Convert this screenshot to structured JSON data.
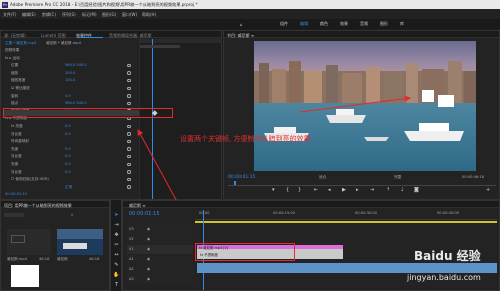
{
  "window": {
    "title": "Adobe Premiere Pro CC 2018 - E:\\百度经验\\图片和视频\\用PR做一个从暗到亮的视频效果.prproj *"
  },
  "menu": {
    "items": [
      "文件(F)",
      "编辑(E)",
      "剪辑(C)",
      "序列(S)",
      "标记(M)",
      "图形(G)",
      "窗口(W)",
      "帮助(H)"
    ]
  },
  "workspace_tabs": {
    "items": [
      "组件",
      "编辑",
      "颜色",
      "效果",
      "音频",
      "图形",
      "库"
    ],
    "active": "编辑"
  },
  "effect_controls": {
    "tabs": [
      "源: (无剪辑)",
      "Lumetri 范围",
      "效果控件",
      "音频剪辑混合器: 威尼斯"
    ],
    "active_tab": "效果控件",
    "clip_label": "主要 * 威尼斯.mp4",
    "sequence_label": "威尼斯 * 威尼斯.mp4",
    "rows": [
      {
        "label": "视频效果",
        "value": ""
      },
      {
        "label": "fx ▸ 运动",
        "value": ""
      },
      {
        "label": "位置",
        "value": "960.0  540.0"
      },
      {
        "label": "缩放",
        "value": "100.0"
      },
      {
        "label": "缩放宽度",
        "value": "100.0"
      },
      {
        "label": "☑ 等比缩放",
        "value": ""
      },
      {
        "label": "旋转",
        "value": "0.0"
      },
      {
        "label": "锚点",
        "value": "960.0  540.0"
      },
      {
        "label": "防闪烁滤镜",
        "value": "0.00"
      },
      {
        "label": "fx ▸ 不透明度",
        "value": ""
      },
      {
        "label": "fx 亮度",
        "value": "0.0"
      },
      {
        "label": "对比度",
        "value": "0.0"
      },
      {
        "label": "时间重映射",
        "value": ""
      },
      {
        "label": "亮度",
        "value": "0.0"
      },
      {
        "label": "对比度",
        "value": "0.0"
      },
      {
        "label": "亮度",
        "value": "0.0"
      },
      {
        "label": "对比度",
        "value": "0.0"
      },
      {
        "label": "☐ 使用旧版(支持 HDR)",
        "value": ""
      },
      {
        "label": "",
        "value": "正常"
      }
    ],
    "time": "00:00:01:15"
  },
  "program_monitor": {
    "tab": "节目: 威尼斯 ≡",
    "timecode": "00:00:01:15",
    "fit": "适合",
    "quality": "完整",
    "duration": "00:00:46:18"
  },
  "annotation": {
    "text": "设置两个关键帧, 方便制作从暗到亮的效果"
  },
  "project_panel": {
    "tabs": [
      "项目: 用PR做一个从暗到亮的视频效果",
      "媒体浏览器",
      "库",
      "信息"
    ],
    "items": [
      {
        "name": "威尼斯.mp4",
        "duration": "46:18"
      },
      {
        "name": "威尼斯",
        "duration": "46:18"
      }
    ]
  },
  "timeline": {
    "tab": "威尼斯 ≡",
    "timecode": "00:00:01:15",
    "ruler": [
      "00:00",
      "00:00:15:00",
      "00:00:30:00",
      "00:00:45:00"
    ],
    "tracks": [
      "V3",
      "V2",
      "V1",
      "A1",
      "A2",
      "A3"
    ],
    "clip_label": "fx 威尼斯.mp4 [V]",
    "clip_sub": "fx 不透明度"
  },
  "watermark": {
    "brand": "Baidu 经验",
    "url": "jingyan.baidu.com"
  }
}
